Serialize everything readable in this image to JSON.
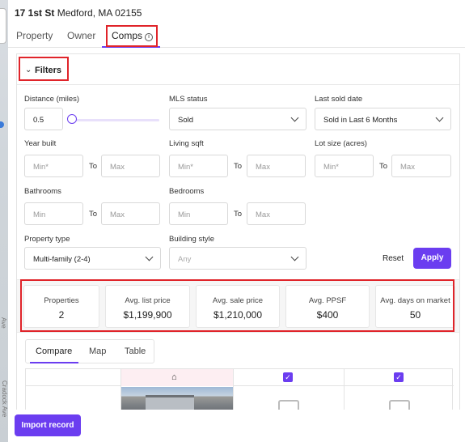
{
  "address": {
    "street": "17 1st St",
    "city": "Medford, MA 02155"
  },
  "tabs": [
    {
      "label": "Property"
    },
    {
      "label": "Owner"
    },
    {
      "label": "Comps"
    }
  ],
  "filters": {
    "title": "Filters",
    "distance": {
      "label": "Distance (miles)",
      "value": "0.5"
    },
    "mls_status": {
      "label": "MLS status",
      "value": "Sold"
    },
    "last_sold": {
      "label": "Last sold date",
      "value": "Sold in Last 6 Months"
    },
    "year_built": {
      "label": "Year built",
      "min": "Min*",
      "max": "Max"
    },
    "living_sqft": {
      "label": "Living sqft",
      "min": "Min*",
      "max": "Max"
    },
    "lot_size": {
      "label": "Lot size (acres)",
      "min": "Min*",
      "max": "Max"
    },
    "bathrooms": {
      "label": "Bathrooms",
      "min": "Min",
      "max": "Max"
    },
    "bedrooms": {
      "label": "Bedrooms",
      "min": "Min",
      "max": "Max"
    },
    "property_type": {
      "label": "Property type",
      "value": "Multi-family (2-4)"
    },
    "building_style": {
      "label": "Building style",
      "value": "Any"
    },
    "to_label": "To",
    "reset_label": "Reset",
    "apply_label": "Apply"
  },
  "stats": [
    {
      "label": "Properties",
      "value": "2"
    },
    {
      "label": "Avg. list price",
      "value": "$1,199,900"
    },
    {
      "label": "Avg. sale price",
      "value": "$1,210,000"
    },
    {
      "label": "Avg. PPSF",
      "value": "$400"
    },
    {
      "label": "Avg. days on market",
      "value": "50"
    }
  ],
  "view_tabs": [
    {
      "label": "Compare"
    },
    {
      "label": "Map"
    },
    {
      "label": "Table"
    }
  ],
  "footer": {
    "import_label": "Import record"
  },
  "map": {
    "street_label_1": "Cradock Ave",
    "street_label_2": "Ave"
  },
  "colors": {
    "accent": "#6b3df0",
    "highlight": "#e0242a"
  }
}
